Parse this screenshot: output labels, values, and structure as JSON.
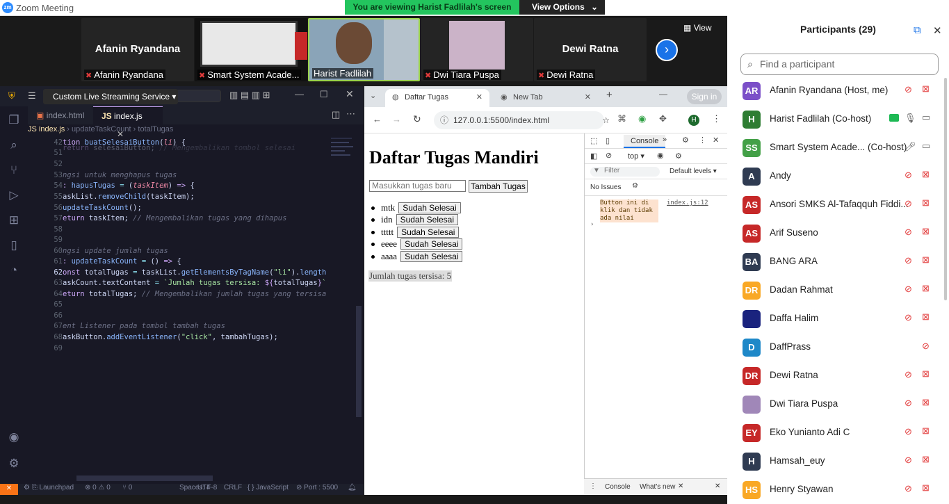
{
  "window": {
    "title": "Zoom Meeting",
    "logo": "zm"
  },
  "share_banner": {
    "text": "You are viewing Harist Fadlilah's screen",
    "options_label": "View Options"
  },
  "gallery": {
    "view_label": "View",
    "tiles": [
      {
        "name": "Afanin Ryandana",
        "label": "Afanin Ryandana"
      },
      {
        "label": "Smart System Acade..."
      },
      {
        "label": "Harist Fadlilah"
      },
      {
        "label": "Dwi Tiara Puspa"
      },
      {
        "name": "Dewi Ratna",
        "label": "Dewi Ratna"
      }
    ]
  },
  "vscode": {
    "search_placeholder": "Daftar Tugas",
    "overlay_title": "Custom Live Streaming Service",
    "tabs": [
      {
        "label": "index.html"
      },
      {
        "label": "index.js"
      }
    ],
    "breadcrumb": [
      "JS index.js",
      "updateTaskCount",
      "totalTugas"
    ],
    "line_numbers": [
      "42",
      "",
      "51",
      "52",
      "53",
      "54",
      "55",
      "56",
      "57",
      "58",
      "59",
      "60",
      "61",
      "62",
      "63",
      "64",
      "65",
      "66",
      "67",
      "68",
      "69"
    ],
    "status": {
      "live": "Launchpad",
      "problems": "0",
      "warnings": "0",
      "ports": "0",
      "spaces": "Spaces: 4",
      "encoding": "UTF-8",
      "eol": "CRLF",
      "lang": "JavaScript",
      "port": "Port : 5500"
    }
  },
  "chrome": {
    "tabs": [
      {
        "label": "Daftar Tugas"
      },
      {
        "label": "New Tab"
      }
    ],
    "url": "127.0.0.1:5500/index.html",
    "signin": "Sign in",
    "profile": "H"
  },
  "app": {
    "title": "Daftar Tugas Mandiri",
    "input_placeholder": "Masukkan tugas baru",
    "add_label": "Tambah Tugas",
    "tasks": [
      "mtk",
      "idn",
      "ttttt",
      "eeee",
      "aaaa"
    ],
    "done_label": "Sudah Selesai",
    "remaining": "Jumlah tugas tersisa: 5"
  },
  "devtools": {
    "tab": "Console",
    "context": "top",
    "filter": "Filter",
    "levels": "Default levels",
    "issues": "No Issues",
    "message": "Button ini di klik dan tidak ada nilai",
    "source": "index.js:12",
    "bottom_tabs": [
      "Console",
      "What's new"
    ]
  },
  "participants": {
    "title": "Participants (29)",
    "search_placeholder": "Find a participant",
    "list": [
      {
        "initials": "AR",
        "name": "Afanin Ryandana (Host, me)",
        "color": "#7b4fc8"
      },
      {
        "initials": "H",
        "name": "Harist Fadlilah (Co-host)",
        "color": "#2e7d32"
      },
      {
        "initials": "SS",
        "name": "Smart System Acade...  (Co-host)",
        "color": "#43a047"
      },
      {
        "initials": "A",
        "name": "Andy",
        "color": "#2f3b52"
      },
      {
        "initials": "AS",
        "name": "Ansori SMKS Al-Tafaqquh Fiddi...",
        "color": "#c62828"
      },
      {
        "initials": "AS",
        "name": "Arif Suseno",
        "color": "#c62828"
      },
      {
        "initials": "BA",
        "name": "BANG ARA",
        "color": "#2f3b52"
      },
      {
        "initials": "DR",
        "name": "Dadan Rahmat",
        "color": "#f9a825"
      },
      {
        "initials": "",
        "name": "Daffa Halim",
        "color": "#1a237e"
      },
      {
        "initials": "D",
        "name": "DaffPrass",
        "color": "#1e88c8"
      },
      {
        "initials": "DR",
        "name": "Dewi Ratna",
        "color": "#c62828"
      },
      {
        "initials": "",
        "name": "Dwi Tiara Puspa",
        "color": "#a087b8"
      },
      {
        "initials": "EY",
        "name": "Eko Yunianto Adi C",
        "color": "#c62828"
      },
      {
        "initials": "H",
        "name": "Hamsah_euy",
        "color": "#2f3b52"
      },
      {
        "initials": "HS",
        "name": "Henry Styawan",
        "color": "#f9a825"
      }
    ]
  }
}
